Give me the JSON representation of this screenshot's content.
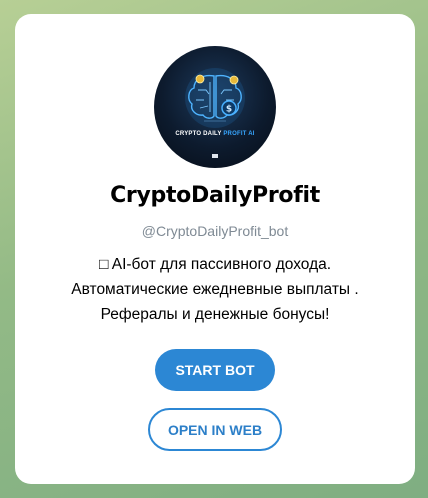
{
  "bot": {
    "name": "CryptoDailyProfit",
    "username": "@CryptoDailyProfit_bot",
    "avatar_text_main": "CRYPTO DAILY",
    "avatar_text_accent": "PROFIT AI",
    "description_lines": [
      "□ AI-бот для пассивного дохода.",
      "Автоматические ежедневные выплаты .",
      "Рефералы и денежные бонусы!"
    ]
  },
  "actions": {
    "start_label": "START BOT",
    "web_label": "OPEN IN WEB"
  },
  "colors": {
    "accent": "#2c87d4",
    "background_green": "#93ba86"
  }
}
